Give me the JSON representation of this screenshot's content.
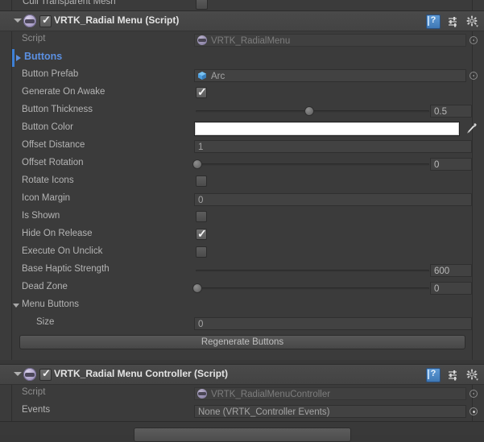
{
  "window": {
    "background": "#393939",
    "panel_background": "#3b3b3b"
  },
  "top_partial_row": {
    "label": "Cull Transparent Mesh",
    "checked": false
  },
  "components": [
    {
      "name": "radial-menu",
      "header": {
        "title": "VRTK_Radial Menu (Script)",
        "enabled": true,
        "expanded": true,
        "icons": [
          "help-icon",
          "preset-icon",
          "gear-icon"
        ]
      },
      "rows": [
        {
          "kind": "object",
          "label": "Script",
          "value": "VRTK_RadialMenu",
          "icon": "script-icon",
          "dimmed": true
        },
        {
          "kind": "section",
          "label": "Buttons",
          "expanded": false,
          "accent": "#5b90e2"
        },
        {
          "kind": "object",
          "label": "Button Prefab",
          "value": "Arc",
          "icon": "prefab-icon",
          "dimmed": false
        },
        {
          "kind": "checkbox",
          "label": "Generate On Awake",
          "checked": true
        },
        {
          "kind": "slider",
          "label": "Button Thickness",
          "value": "0.5",
          "fill": 0.5,
          "knob": true
        },
        {
          "kind": "color",
          "label": "Button Color",
          "value": "#FFFFFF"
        },
        {
          "kind": "text",
          "label": "Offset Distance",
          "value": "1"
        },
        {
          "kind": "slider",
          "label": "Offset Rotation",
          "value": "0",
          "fill": 0.0,
          "knob": true
        },
        {
          "kind": "checkbox",
          "label": "Rotate Icons",
          "checked": false
        },
        {
          "kind": "text",
          "label": "Icon Margin",
          "value": "0"
        },
        {
          "kind": "checkbox",
          "label": "Is Shown",
          "checked": false
        },
        {
          "kind": "checkbox",
          "label": "Hide On Release",
          "checked": true
        },
        {
          "kind": "checkbox",
          "label": "Execute On Unclick",
          "checked": false
        },
        {
          "kind": "slider",
          "label": "Base Haptic Strength",
          "value": "600",
          "fill": 1.0,
          "knob": false
        },
        {
          "kind": "slider",
          "label": "Dead Zone",
          "value": "0",
          "fill": 0.0,
          "knob": true
        },
        {
          "kind": "subfoldout",
          "label": "Menu Buttons",
          "expanded": true
        },
        {
          "kind": "text",
          "label": "Size",
          "value": "0",
          "indent": 2
        },
        {
          "kind": "button",
          "label": "Regenerate Buttons"
        }
      ]
    },
    {
      "name": "radial-menu-controller",
      "header": {
        "title": "VRTK_Radial Menu Controller (Script)",
        "enabled": true,
        "expanded": true,
        "icons": [
          "help-icon",
          "preset-icon",
          "gear-icon"
        ]
      },
      "rows": [
        {
          "kind": "object",
          "label": "Script",
          "value": "VRTK_RadialMenuController",
          "icon": "script-icon",
          "dimmed": true
        },
        {
          "kind": "object",
          "label": "Events",
          "value": "None (VRTK_Controller Events)",
          "icon": "none",
          "dimmed": false
        }
      ]
    }
  ],
  "bottom": {
    "add_component_label": ""
  }
}
